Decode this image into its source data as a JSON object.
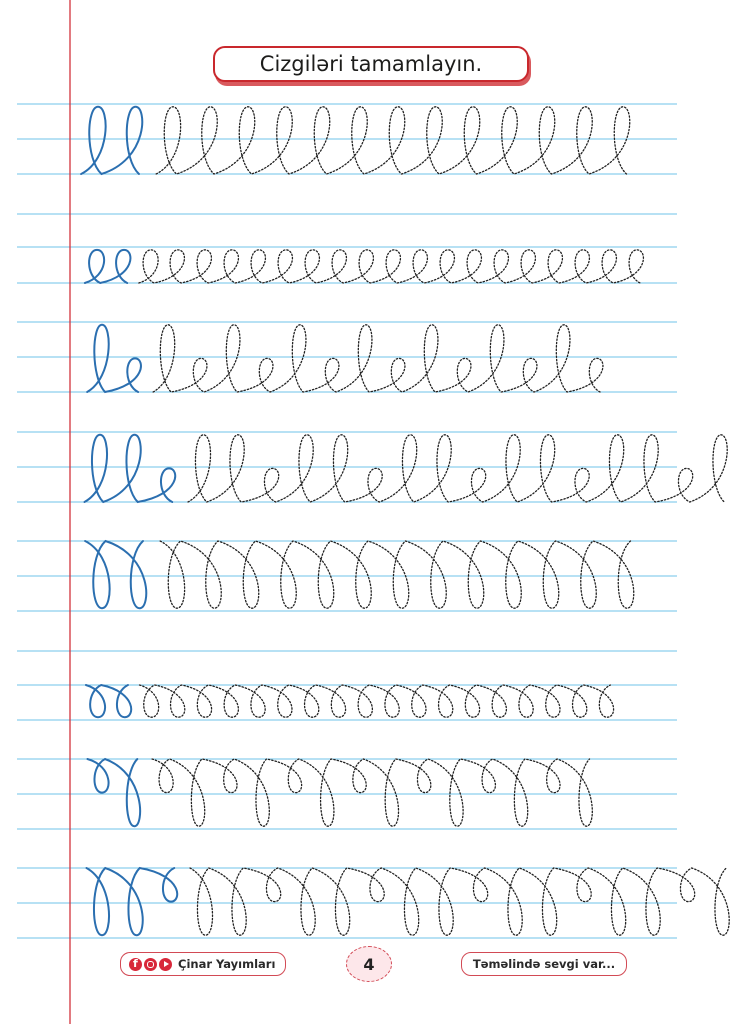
{
  "instruction": "Cizgiləri tamamlayın.",
  "footer": {
    "publisher": "Çinar Yayımları",
    "page_number": "4",
    "slogan": "Təməlində sevgi var..."
  },
  "social_icons": [
    "facebook-icon",
    "instagram-icon",
    "youtube-icon"
  ],
  "colors": {
    "guide_lines": "#6fc3e8",
    "margin_line": "#d2323c",
    "solid_trace": "#2b6fb0",
    "dotted_trace": "#222222",
    "accent": "#c9282d"
  },
  "exercises": [
    {
      "pattern": "loops-up",
      "solid_loops": 2,
      "dotted_loops": 13
    },
    {
      "pattern": "small-loops-up",
      "solid_loops": 2,
      "dotted_loops": 19
    },
    {
      "pattern": "tall-small-loops-alternating",
      "solid_loops": 2,
      "dotted_loops": 14
    },
    {
      "pattern": "tall-tall-small-loops",
      "solid_loops": 3,
      "dotted_loops": 16
    },
    {
      "pattern": "loops-down",
      "solid_loops": 2,
      "dotted_loops": 13
    },
    {
      "pattern": "small-loops-down",
      "solid_loops": 2,
      "dotted_loops": 18
    },
    {
      "pattern": "small-tall-loops-down-alternating",
      "solid_loops": 2,
      "dotted_loops": 14
    },
    {
      "pattern": "tall-tall-small-loops-down",
      "solid_loops": 3,
      "dotted_loops": 16
    }
  ]
}
